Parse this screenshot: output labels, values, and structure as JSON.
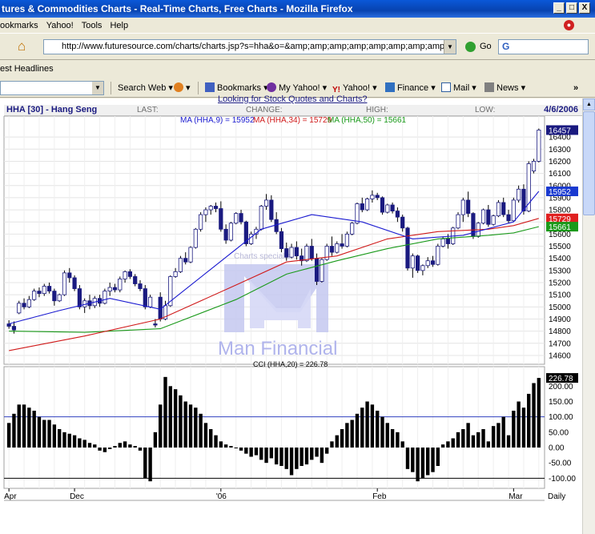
{
  "window": {
    "title": "tures & Commodities Charts - Real-Time Charts, Free Charts - Mozilla Firefox",
    "buttons": [
      "_",
      "□",
      "X"
    ]
  },
  "menu": [
    "ookmarks",
    "Yahoo!",
    "Tools",
    "Help"
  ],
  "nav": {
    "url": "http://www.futuresource.com/charts/charts.jsp?s=hha&o=&amp;amp;amp;amp;amp;amp;amp;amp;amp;amp;amp;a=D",
    "go_label": "Go",
    "search_text": "G"
  },
  "bookmarks_bar": {
    "item": "est Headlines"
  },
  "yahoo_toolbar": {
    "search_web": "Search Web",
    "bookmarks": "Bookmarks",
    "my_yahoo": "My Yahoo!",
    "yahoo": "Yahoo!",
    "finance": "Finance",
    "mail": "Mail",
    "news": "News",
    "more": "»"
  },
  "page": {
    "overlay_link": "Looking for Stock Quotes and Charts?",
    "header": {
      "symbol": "HHA [30] - Hang Seng",
      "last": "LAST:",
      "change": "CHANGE:",
      "high": "HIGH:",
      "low": "LOW:",
      "date": "4/6/2006"
    },
    "ma_legend": {
      "ma9": "MA (HHA,9) = 15952",
      "ma34": "MA (HHA,34) = 15729",
      "ma50": "MA (HHA,50) = 15661"
    },
    "watermark": "Man Financial",
    "watermark_small": "Charts specialist",
    "cci_label": "CCI (HHA,20) = 226.78",
    "period": "Daily",
    "colors": {
      "ma9": "#1a1ad0",
      "ma34": "#d01a1a",
      "ma50": "#1a9a1a",
      "watermark": "#b0b4ec"
    }
  },
  "chart_data": [
    {
      "type": "candlestick",
      "title": "HHA [30] - Hang Seng",
      "y_ticks": [
        14600,
        14700,
        14800,
        14900,
        15000,
        15100,
        15200,
        15300,
        15400,
        15500,
        15600,
        15700,
        15800,
        15900,
        16000,
        16100,
        16200,
        16300,
        16400
      ],
      "ylim": [
        14560,
        16480
      ],
      "x_tick_labels": [
        "Dec",
        "'06",
        "Feb",
        "Mar",
        "Apr"
      ],
      "price_labels": [
        {
          "label": "16457",
          "value": 16457
        },
        {
          "label": "15952",
          "value": 15952
        },
        {
          "label": "15729",
          "value": 15729
        },
        {
          "label": "15661",
          "value": 15661
        }
      ],
      "candles": [
        [
          14860,
          14890,
          14820,
          14840
        ],
        [
          14840,
          14880,
          14780,
          14810
        ],
        [
          14950,
          15050,
          14940,
          15030
        ],
        [
          15030,
          15070,
          14980,
          15000
        ],
        [
          15000,
          15090,
          14990,
          15060
        ],
        [
          15060,
          15150,
          15050,
          15130
        ],
        [
          15130,
          15160,
          15080,
          15110
        ],
        [
          15110,
          15190,
          15090,
          15170
        ],
        [
          15170,
          15200,
          15110,
          15130
        ],
        [
          15130,
          15150,
          15010,
          15050
        ],
        [
          15050,
          15110,
          15040,
          15100
        ],
        [
          15100,
          15300,
          15090,
          15280
        ],
        [
          15280,
          15320,
          15200,
          15240
        ],
        [
          15240,
          15260,
          15130,
          15150
        ],
        [
          15150,
          15180,
          14980,
          15000
        ],
        [
          15000,
          15070,
          14950,
          15050
        ],
        [
          15050,
          15100,
          14980,
          15010
        ],
        [
          15010,
          15090,
          14990,
          15070
        ],
        [
          15070,
          15100,
          15000,
          15030
        ],
        [
          15030,
          15150,
          15020,
          15130
        ],
        [
          15130,
          15200,
          15090,
          15160
        ],
        [
          15160,
          15190,
          15120,
          15140
        ],
        [
          15140,
          15250,
          15120,
          15230
        ],
        [
          15230,
          15300,
          15200,
          15290
        ],
        [
          15290,
          15310,
          15230,
          15250
        ],
        [
          15250,
          15270,
          15170,
          15190
        ],
        [
          15190,
          15220,
          15130,
          15150
        ],
        [
          15150,
          15180,
          14980,
          15000
        ],
        [
          15000,
          15100,
          14990,
          15080
        ],
        [
          14860,
          14900,
          14830,
          14850
        ],
        [
          15080,
          15120,
          14880,
          14900
        ],
        [
          14900,
          15050,
          14890,
          15010
        ],
        [
          15010,
          15260,
          15000,
          15250
        ],
        [
          15250,
          15320,
          15240,
          15290
        ],
        [
          15290,
          15420,
          15280,
          15400
        ],
        [
          15400,
          15450,
          15350,
          15370
        ],
        [
          15370,
          15500,
          15360,
          15490
        ],
        [
          15490,
          15650,
          15480,
          15640
        ],
        [
          15640,
          15780,
          15620,
          15760
        ],
        [
          15760,
          15820,
          15700,
          15800
        ],
        [
          15800,
          15840,
          15760,
          15830
        ],
        [
          15830,
          15860,
          15780,
          15810
        ],
        [
          15810,
          15870,
          15620,
          15640
        ],
        [
          15640,
          15680,
          15520,
          15550
        ],
        [
          15550,
          15700,
          15540,
          15690
        ],
        [
          15690,
          15780,
          15680,
          15770
        ],
        [
          15770,
          15800,
          15680,
          15700
        ],
        [
          15700,
          15710,
          15500,
          15520
        ],
        [
          15520,
          15620,
          15510,
          15600
        ],
        [
          15600,
          15660,
          15560,
          15640
        ],
        [
          15640,
          15840,
          15630,
          15830
        ],
        [
          15830,
          15930,
          15800,
          15880
        ],
        [
          15880,
          15920,
          15700,
          15720
        ],
        [
          15720,
          15780,
          15600,
          15620
        ],
        [
          15620,
          15650,
          15450,
          15480
        ],
        [
          15480,
          15530,
          15380,
          15410
        ],
        [
          15410,
          15520,
          15400,
          15490
        ],
        [
          15490,
          15540,
          15390,
          15420
        ],
        [
          15420,
          15480,
          15340,
          15380
        ],
        [
          15380,
          15520,
          15370,
          15500
        ],
        [
          15500,
          15560,
          15380,
          15400
        ],
        [
          15400,
          15440,
          15180,
          15210
        ],
        [
          15210,
          15400,
          15200,
          15390
        ],
        [
          15390,
          15520,
          15380,
          15500
        ],
        [
          15500,
          15580,
          15420,
          15450
        ],
        [
          15450,
          15540,
          15440,
          15520
        ],
        [
          15520,
          15600,
          15480,
          15500
        ],
        [
          15500,
          15620,
          15490,
          15600
        ],
        [
          15600,
          15700,
          15590,
          15690
        ],
        [
          15690,
          15860,
          15680,
          15850
        ],
        [
          15850,
          15900,
          15780,
          15800
        ],
        [
          15800,
          15900,
          15790,
          15890
        ],
        [
          15890,
          15960,
          15860,
          15920
        ],
        [
          15920,
          15940,
          15880,
          15900
        ],
        [
          15900,
          15910,
          15760,
          15780
        ],
        [
          15780,
          15850,
          15770,
          15840
        ],
        [
          15840,
          15860,
          15770,
          15790
        ],
        [
          15790,
          15820,
          15700,
          15740
        ],
        [
          15740,
          15760,
          15620,
          15650
        ],
        [
          15650,
          15660,
          15300,
          15320
        ],
        [
          15320,
          15440,
          15240,
          15420
        ],
        [
          15420,
          15430,
          15280,
          15300
        ],
        [
          15300,
          15350,
          15260,
          15340
        ],
        [
          15340,
          15410,
          15320,
          15380
        ],
        [
          15380,
          15420,
          15330,
          15350
        ],
        [
          15350,
          15520,
          15340,
          15500
        ],
        [
          15500,
          15580,
          15490,
          15560
        ],
        [
          15560,
          15600,
          15480,
          15520
        ],
        [
          15520,
          15660,
          15510,
          15650
        ],
        [
          15650,
          15780,
          15640,
          15760
        ],
        [
          15760,
          15900,
          15700,
          15880
        ],
        [
          15880,
          15950,
          15740,
          15770
        ],
        [
          15770,
          15780,
          15560,
          15580
        ],
        [
          15580,
          15700,
          15570,
          15690
        ],
        [
          15690,
          15810,
          15680,
          15800
        ],
        [
          15800,
          15840,
          15660,
          15680
        ],
        [
          15680,
          15760,
          15670,
          15750
        ],
        [
          15750,
          15880,
          15740,
          15860
        ],
        [
          15860,
          15900,
          15740,
          15760
        ],
        [
          15760,
          15800,
          15690,
          15710
        ],
        [
          15710,
          15900,
          15700,
          15880
        ],
        [
          15880,
          16000,
          15860,
          15970
        ],
        [
          15970,
          16010,
          15760,
          15790
        ],
        [
          15790,
          16200,
          15780,
          16180
        ],
        [
          16120,
          16220,
          16100,
          16200
        ],
        [
          16200,
          16470,
          16190,
          16457
        ]
      ],
      "ma9": [
        [
          0,
          14860
        ],
        [
          10,
          14970
        ],
        [
          20,
          15070
        ],
        [
          30,
          14980
        ],
        [
          40,
          15310
        ],
        [
          50,
          15640
        ],
        [
          60,
          15760
        ],
        [
          70,
          15700
        ],
        [
          80,
          15560
        ],
        [
          90,
          15590
        ],
        [
          100,
          15700
        ],
        [
          105,
          15952
        ]
      ],
      "ma34": [
        [
          0,
          14640
        ],
        [
          15,
          14760
        ],
        [
          30,
          14900
        ],
        [
          45,
          15180
        ],
        [
          55,
          15370
        ],
        [
          65,
          15420
        ],
        [
          75,
          15560
        ],
        [
          85,
          15620
        ],
        [
          95,
          15640
        ],
        [
          100,
          15670
        ],
        [
          105,
          15729
        ]
      ],
      "ma50": [
        [
          0,
          14800
        ],
        [
          15,
          14790
        ],
        [
          30,
          14820
        ],
        [
          45,
          15060
        ],
        [
          55,
          15270
        ],
        [
          65,
          15380
        ],
        [
          75,
          15480
        ],
        [
          85,
          15560
        ],
        [
          95,
          15590
        ],
        [
          100,
          15610
        ],
        [
          105,
          15661
        ]
      ]
    },
    {
      "type": "bar",
      "title": "CCI (HHA,20) = 226.78",
      "y_ticks": [
        -100,
        -50,
        0,
        50,
        100,
        150,
        200
      ],
      "ylim": [
        -120,
        240
      ],
      "reference_lines": [
        100,
        -100
      ],
      "value_label": "226.78",
      "values": [
        80,
        110,
        140,
        140,
        130,
        120,
        100,
        90,
        90,
        75,
        60,
        50,
        45,
        40,
        30,
        25,
        15,
        10,
        -10,
        -15,
        -5,
        5,
        15,
        20,
        10,
        5,
        -10,
        -100,
        -110,
        50,
        140,
        230,
        200,
        190,
        170,
        150,
        140,
        130,
        110,
        80,
        60,
        40,
        20,
        10,
        5,
        0,
        -10,
        -20,
        -30,
        -25,
        -40,
        -50,
        -35,
        -55,
        -60,
        -70,
        -90,
        -70,
        -60,
        -55,
        -40,
        -30,
        -50,
        -20,
        20,
        40,
        60,
        80,
        90,
        110,
        130,
        150,
        140,
        120,
        100,
        80,
        60,
        50,
        20,
        -70,
        -80,
        -110,
        -100,
        -90,
        -80,
        -60,
        10,
        20,
        30,
        50,
        60,
        80,
        40,
        50,
        60,
        20,
        70,
        80,
        100,
        40,
        120,
        150,
        130,
        175,
        210,
        226.78
      ]
    }
  ]
}
